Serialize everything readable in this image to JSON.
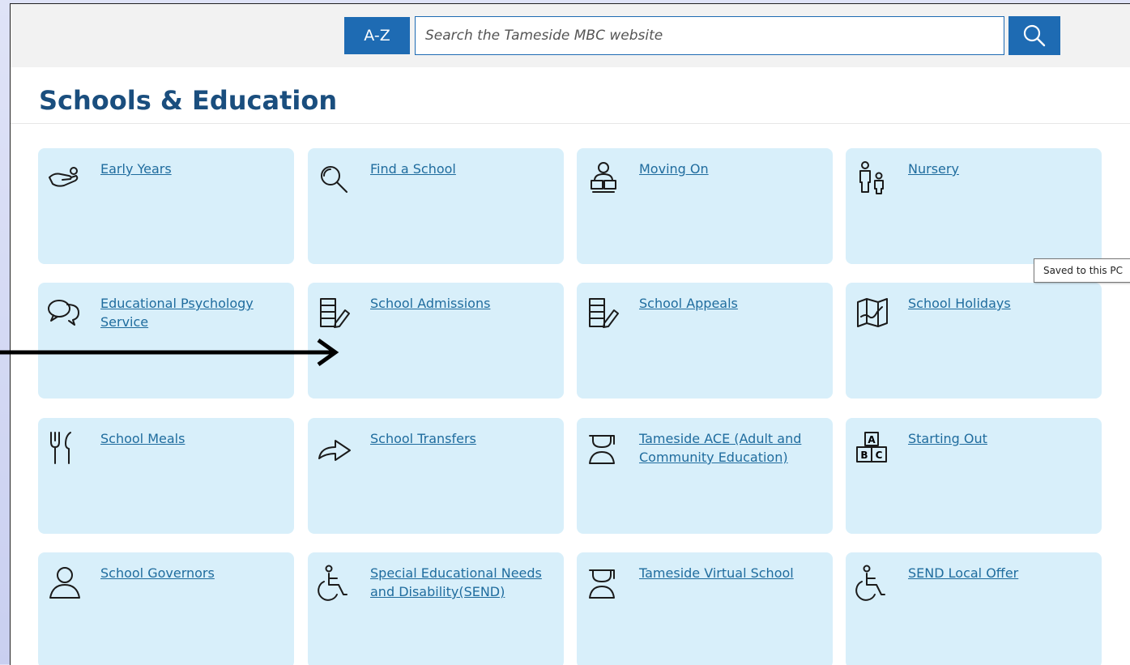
{
  "header": {
    "az_label": "A-Z",
    "search_placeholder": "Search the Tameside MBC website",
    "search_icon": "search-icon"
  },
  "page": {
    "title": "Schools & Education"
  },
  "tooltip": "Saved to this PC",
  "colors": {
    "brand_blue": "#1e6bb3",
    "tile_bg": "#d8effa",
    "link": "#1f6c9e",
    "title": "#1a4e7e"
  },
  "tiles": [
    {
      "label": "Early Years",
      "icon": "hand-icon"
    },
    {
      "label": "Find a School",
      "icon": "magnifier-icon"
    },
    {
      "label": "Moving On",
      "icon": "reader-icon"
    },
    {
      "label": "Nursery",
      "icon": "parent-child-icon"
    },
    {
      "label": "Educational Psychology Service",
      "icon": "speech-bubbles-icon"
    },
    {
      "label": "School Admissions",
      "icon": "form-pen-icon"
    },
    {
      "label": "School Appeals",
      "icon": "form-pen-icon"
    },
    {
      "label": "School Holidays",
      "icon": "map-icon"
    },
    {
      "label": "School Meals",
      "icon": "cutlery-icon"
    },
    {
      "label": "School Transfers",
      "icon": "arrow-icon"
    },
    {
      "label": "Tameside ACE (Adult and Community Education)",
      "icon": "graduate-icon"
    },
    {
      "label": "Starting Out",
      "icon": "abc-blocks-icon"
    },
    {
      "label": "School Governors",
      "icon": "person-icon"
    },
    {
      "label": "Special Educational Needs and Disability(SEND)",
      "icon": "wheelchair-icon"
    },
    {
      "label": "Tameside Virtual School",
      "icon": "graduate-icon"
    },
    {
      "label": "SEND Local Offer",
      "icon": "wheelchair-icon"
    }
  ]
}
